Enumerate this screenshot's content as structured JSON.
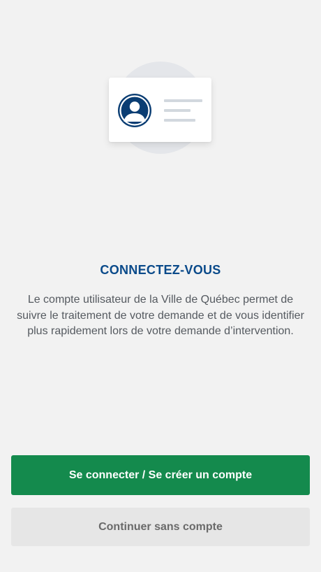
{
  "illustration": {
    "icon": "user-id-card-icon",
    "avatar_color": "#0a3d73",
    "line_color": "#d2d8de",
    "circle_color": "#e4e6ea"
  },
  "main": {
    "title": "CONNECTEZ-VOUS",
    "description": "Le compte utilisateur de la Ville de Québec permet de suivre le traitement de votre demande et de vous identifier plus rapidement lors de votre demande d’intervention."
  },
  "actions": {
    "primary_label": "Se connecter / Se créer un compte",
    "secondary_label": "Continuer sans compte"
  },
  "colors": {
    "title": "#0a4a8a",
    "primary_button": "#148a4d",
    "secondary_button": "#e6e6e6",
    "background": "#f2f2f2"
  }
}
